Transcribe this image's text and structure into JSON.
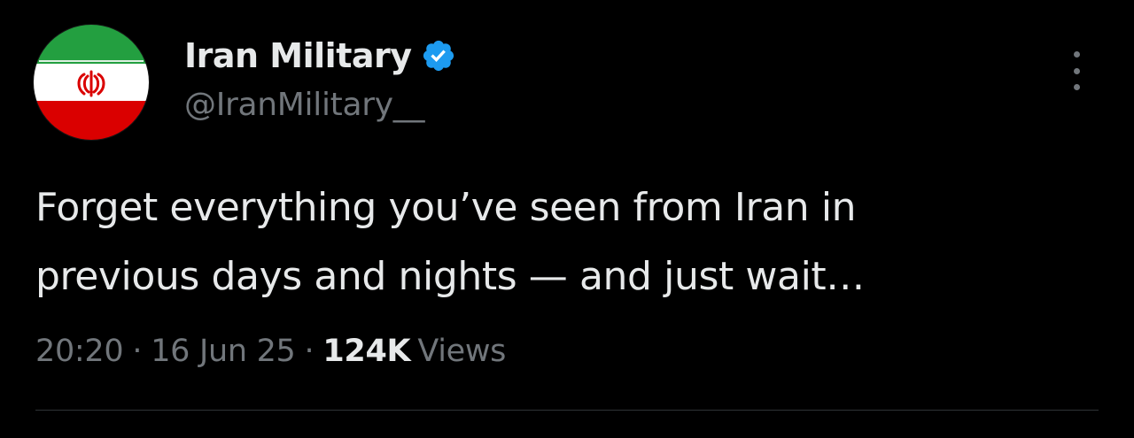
{
  "author": {
    "display_name": "Iran Military",
    "handle": "@IranMilitary__",
    "verified": true,
    "avatar_icon": "iran-flag-icon",
    "verified_icon": "verified-badge-icon",
    "verified_color": "#1d9bf0"
  },
  "tweet": {
    "lines": [
      "Forget everything you’ve seen from Iran in",
      "previous days and nights — and just wait…"
    ]
  },
  "meta": {
    "time": "20:20",
    "separator": "·",
    "date": "16 Jun 25",
    "views_count": "124K",
    "views_label": "Views"
  },
  "menu": {
    "icon": "more-vertical-icon"
  },
  "colors": {
    "background": "#000000",
    "primary_text": "#e7e9ea",
    "secondary_text": "#71767b",
    "flag_green": "#239f40",
    "flag_white": "#ffffff",
    "flag_red": "#da0000"
  }
}
